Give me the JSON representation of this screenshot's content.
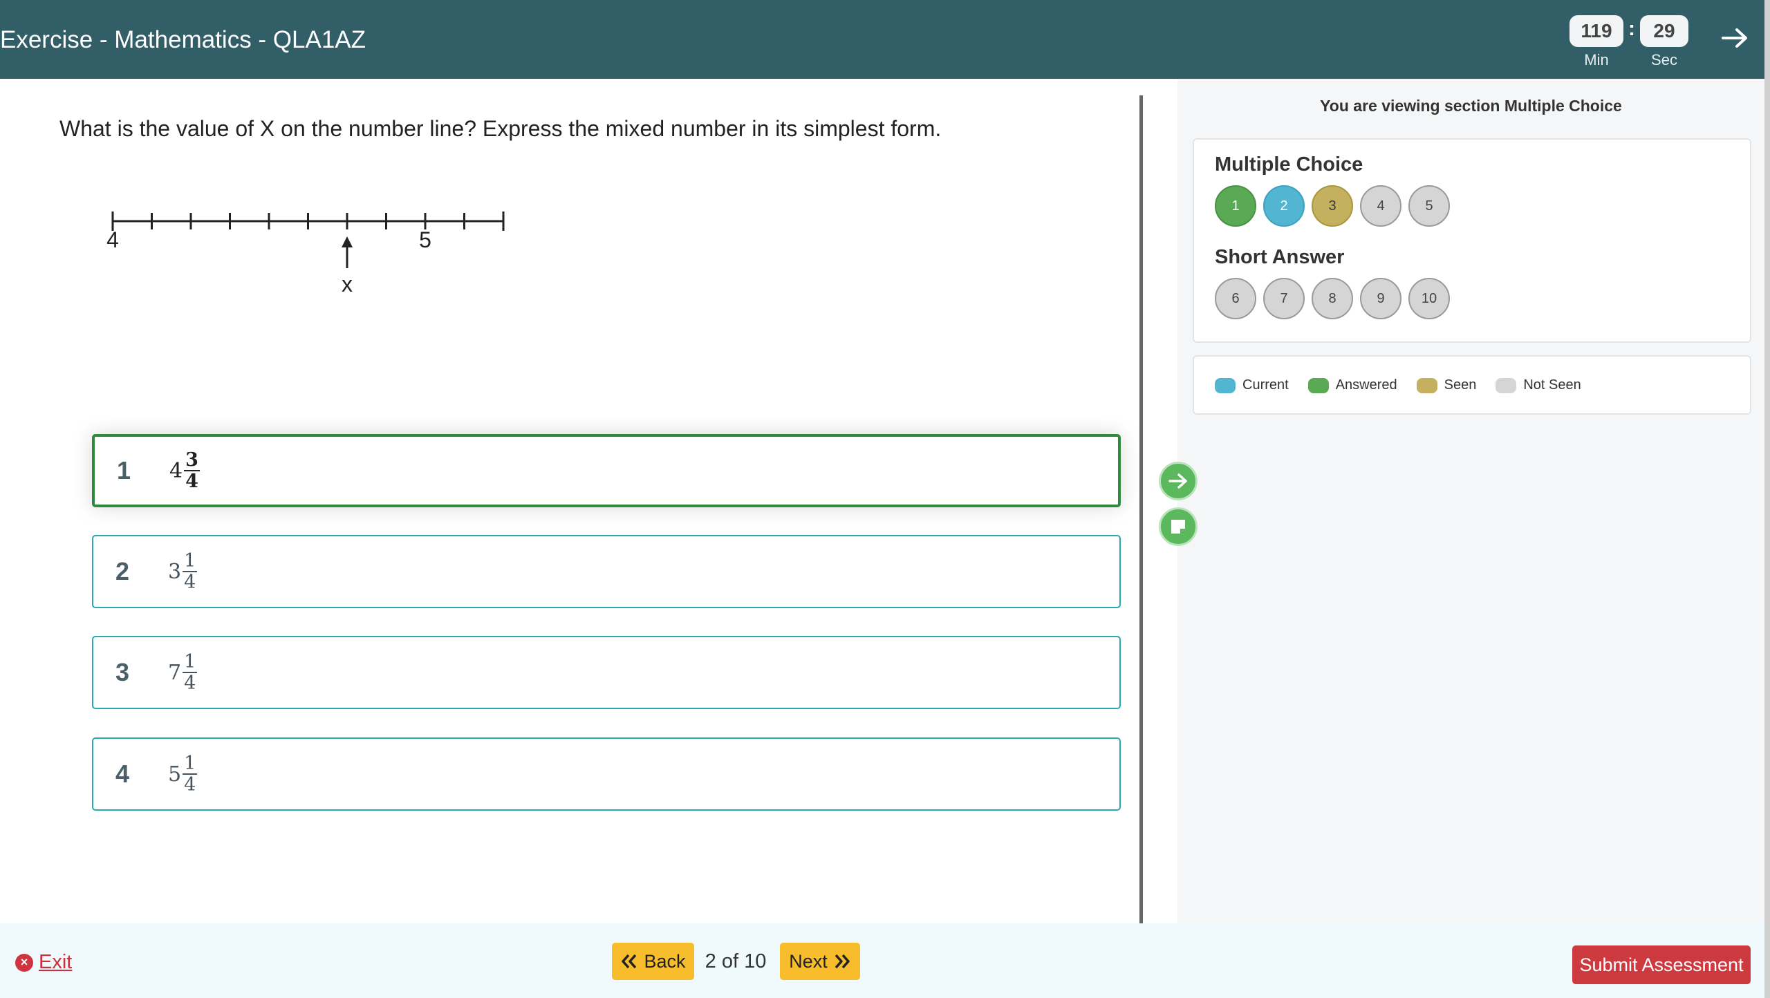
{
  "header": {
    "title": "Exercise - Mathematics - QLA1AZ",
    "timer": {
      "minutes": "119",
      "seconds": "29",
      "min_label": "Min",
      "sec_label": "Sec",
      "separator": ":"
    }
  },
  "question": {
    "text": "What is the value of X on the number line? Express the mixed number in its simplest form.",
    "number_line": {
      "start_label": "4",
      "end_label": "5",
      "marker_label": "x"
    }
  },
  "options": [
    {
      "number": "1",
      "whole": "4",
      "numerator": "3",
      "denominator": "4",
      "selected": true
    },
    {
      "number": "2",
      "whole": "3",
      "numerator": "1",
      "denominator": "4",
      "selected": false
    },
    {
      "number": "3",
      "whole": "7",
      "numerator": "1",
      "denominator": "4",
      "selected": false
    },
    {
      "number": "4",
      "whole": "5",
      "numerator": "1",
      "denominator": "4",
      "selected": false
    }
  ],
  "sidebar": {
    "heading": "You are viewing section Multiple Choice",
    "sections": [
      {
        "title": "Multiple Choice",
        "items": [
          {
            "label": "1",
            "status": "answered"
          },
          {
            "label": "2",
            "status": "current"
          },
          {
            "label": "3",
            "status": "seen"
          },
          {
            "label": "4",
            "status": "not-seen"
          },
          {
            "label": "5",
            "status": "not-seen"
          }
        ]
      },
      {
        "title": "Short Answer",
        "items": [
          {
            "label": "6",
            "status": "not-seen"
          },
          {
            "label": "7",
            "status": "not-seen"
          },
          {
            "label": "8",
            "status": "not-seen"
          },
          {
            "label": "9",
            "status": "not-seen"
          },
          {
            "label": "10",
            "status": "not-seen"
          }
        ]
      }
    ],
    "legend": [
      {
        "label": "Current",
        "color": "#52b5d1"
      },
      {
        "label": "Answered",
        "color": "#5aa955"
      },
      {
        "label": "Seen",
        "color": "#c4b05e"
      },
      {
        "label": "Not Seen",
        "color": "#d5d5d5"
      }
    ]
  },
  "footer": {
    "exit_label": "Exit",
    "back_label": "Back",
    "next_label": "Next",
    "page_indicator": "2 of 10",
    "submit_label": "Submit Assessment"
  },
  "colors": {
    "header_bg": "#325e67",
    "option_border": "#27a9b0",
    "selected_border": "#2e8b3d",
    "nav_button": "#f7bd2c",
    "submit_button": "#cc3a40"
  }
}
